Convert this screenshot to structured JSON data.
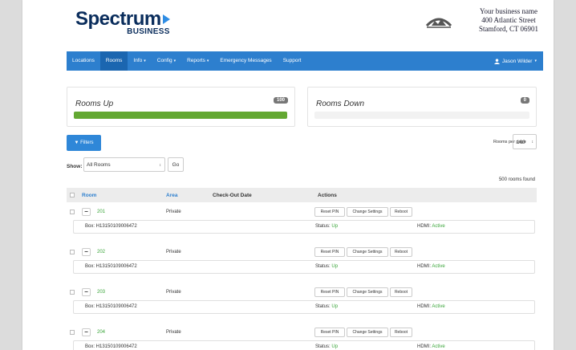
{
  "brand": {
    "logo_main": "Spectrum",
    "logo_sub": "BUSINESS",
    "biz_name": "Your business name",
    "biz_street": "400 Atlantic Street",
    "biz_city": "Stamford, CT 06901"
  },
  "nav": {
    "items": [
      {
        "label": "Locations",
        "active": false,
        "dropdown": false
      },
      {
        "label": "Rooms",
        "active": true,
        "dropdown": false
      },
      {
        "label": "Info",
        "active": false,
        "dropdown": true
      },
      {
        "label": "Config",
        "active": false,
        "dropdown": true
      },
      {
        "label": "Reports",
        "active": false,
        "dropdown": true
      },
      {
        "label": "Emergency Messages",
        "active": false,
        "dropdown": false
      },
      {
        "label": "Support",
        "active": false,
        "dropdown": false
      }
    ],
    "user": "Jason Wilder",
    "caret": "▾"
  },
  "summary": {
    "up": {
      "title": "Rooms Up",
      "count": "100",
      "fill": 1.0,
      "color": "#63a832"
    },
    "down": {
      "title": "Rooms Down",
      "count": "0",
      "fill": 0.0,
      "color": "#f0f0f0"
    }
  },
  "controls": {
    "filters_label": "Filters",
    "rooms_per_page_label": "Rooms per page",
    "rooms_per_page_value": "100",
    "show_label": "Show:",
    "show_value": "All Rooms",
    "go_label": "Go",
    "found_text": "500 rooms found"
  },
  "table": {
    "headers": {
      "room": "Room",
      "area": "Area",
      "checkout": "Check-Out Date",
      "actions": "Actions"
    },
    "action_labels": {
      "reset": "Reset PIN",
      "change": "Change Settings",
      "reboot": "Reboot"
    },
    "rows": [
      {
        "room": "201",
        "area": "Private",
        "box": "Box: H13150109006472",
        "status_label": "Status:",
        "status": "Up",
        "hdmi_label": "HDMI:",
        "hdmi": "Active"
      },
      {
        "room": "202",
        "area": "Private",
        "box": "Box: H13150109006472",
        "status_label": "Status:",
        "status": "Up",
        "hdmi_label": "HDMI:",
        "hdmi": "Active"
      },
      {
        "room": "203",
        "area": "Private",
        "box": "Box: H13150109006472",
        "status_label": "Status:",
        "status": "Up",
        "hdmi_label": "HDMI:",
        "hdmi": "Active"
      },
      {
        "room": "204",
        "area": "Private",
        "box": "Box: H13150109006472",
        "status_label": "Status:",
        "status": "Up",
        "hdmi_label": "HDMI:",
        "hdmi": "Active"
      }
    ]
  },
  "colors": {
    "nav": "#2d7fce",
    "accent": "#2f87d8",
    "status_ok": "#3aa53a"
  }
}
